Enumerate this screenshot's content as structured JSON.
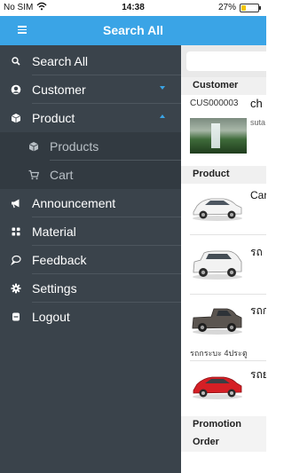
{
  "status_bar": {
    "carrier": "No SIM",
    "time": "14:38",
    "battery_percent": "27%",
    "battery_level": 0.27
  },
  "header": {
    "title": "Search All",
    "menu_icon": "hamburger-icon",
    "color": "#3aa4e6"
  },
  "drawer": {
    "background": "#3a434b",
    "accent": "#3aa4e6",
    "items": [
      {
        "label": "Search All",
        "icon": "search-icon"
      },
      {
        "label": "Customer",
        "icon": "user-icon",
        "expandable": true,
        "expanded": false
      },
      {
        "label": "Product",
        "icon": "box-icon",
        "expandable": true,
        "expanded": true
      },
      {
        "label": "Products",
        "icon": "box-icon",
        "sub": true
      },
      {
        "label": "Cart",
        "icon": "cart-icon",
        "sub": true
      },
      {
        "label": "Announcement",
        "icon": "megaphone-icon"
      },
      {
        "label": "Material",
        "icon": "grid-icon"
      },
      {
        "label": "Feedback",
        "icon": "chat-icon"
      },
      {
        "label": "Settings",
        "icon": "gear-icon"
      },
      {
        "label": "Logout",
        "icon": "logout-icon"
      }
    ]
  },
  "content": {
    "customer_section": "Customer",
    "customer_code": "CUS000003",
    "customer_name_fragment": "ch",
    "customer_sub_fragment": "suta",
    "product_section": "Product",
    "products": [
      {
        "label": "Car",
        "icon": "white-sedan"
      },
      {
        "label": "รถ",
        "icon": "white-suv"
      },
      {
        "label": "รถก",
        "icon": "dark-pickup"
      },
      {
        "label": "รถย",
        "icon": "red-sedan"
      }
    ],
    "product_note": "รถกระบะ 4ประตู",
    "promotion_section": "Promotion",
    "order_section": "Order"
  }
}
